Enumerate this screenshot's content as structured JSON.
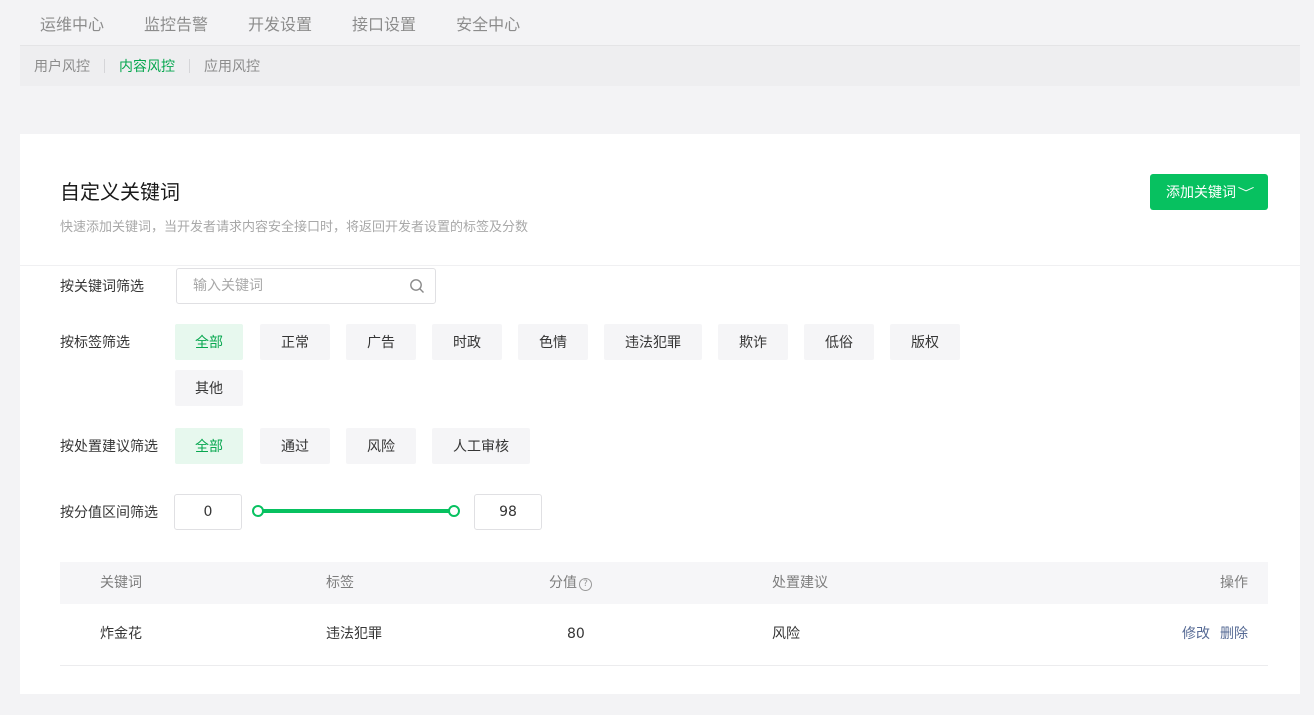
{
  "top_tabs": [
    "运维中心",
    "监控告警",
    "开发设置",
    "接口设置",
    "安全中心"
  ],
  "sub_tabs": [
    "用户风控",
    "内容风控",
    "应用风控"
  ],
  "header": {
    "title": "自定义关键词",
    "description": "快速添加关键词，当开发者请求内容安全接口时，将返回开发者设置的标签及分数",
    "add_button": "添加关键词",
    "add_button_icon": "chevron-down-icon"
  },
  "filters": {
    "keyword_label": "按关键词筛选",
    "keyword_placeholder": "输入关键词",
    "tag_label": "按标签筛选",
    "tags": [
      "全部",
      "正常",
      "广告",
      "时政",
      "色情",
      "违法犯罪",
      "欺诈",
      "低俗",
      "版权",
      "其他"
    ],
    "suggestion_label": "按处置建议筛选",
    "suggestions": [
      "全部",
      "通过",
      "风险",
      "人工审核"
    ],
    "score_label": "按分值区间筛选",
    "score_min": "0",
    "score_max": "98"
  },
  "table": {
    "columns": [
      "关键词",
      "标签",
      "分值",
      "处置建议",
      "操作"
    ],
    "score_help_icon": "?",
    "rows": [
      {
        "keyword": "炸金花",
        "tag": "违法犯罪",
        "score": "80",
        "suggestion": "风险",
        "edit": "修改",
        "delete": "删除"
      }
    ]
  },
  "colors": {
    "accent": "#07c160",
    "accent_text": "#07a74f",
    "link": "#576b95"
  }
}
